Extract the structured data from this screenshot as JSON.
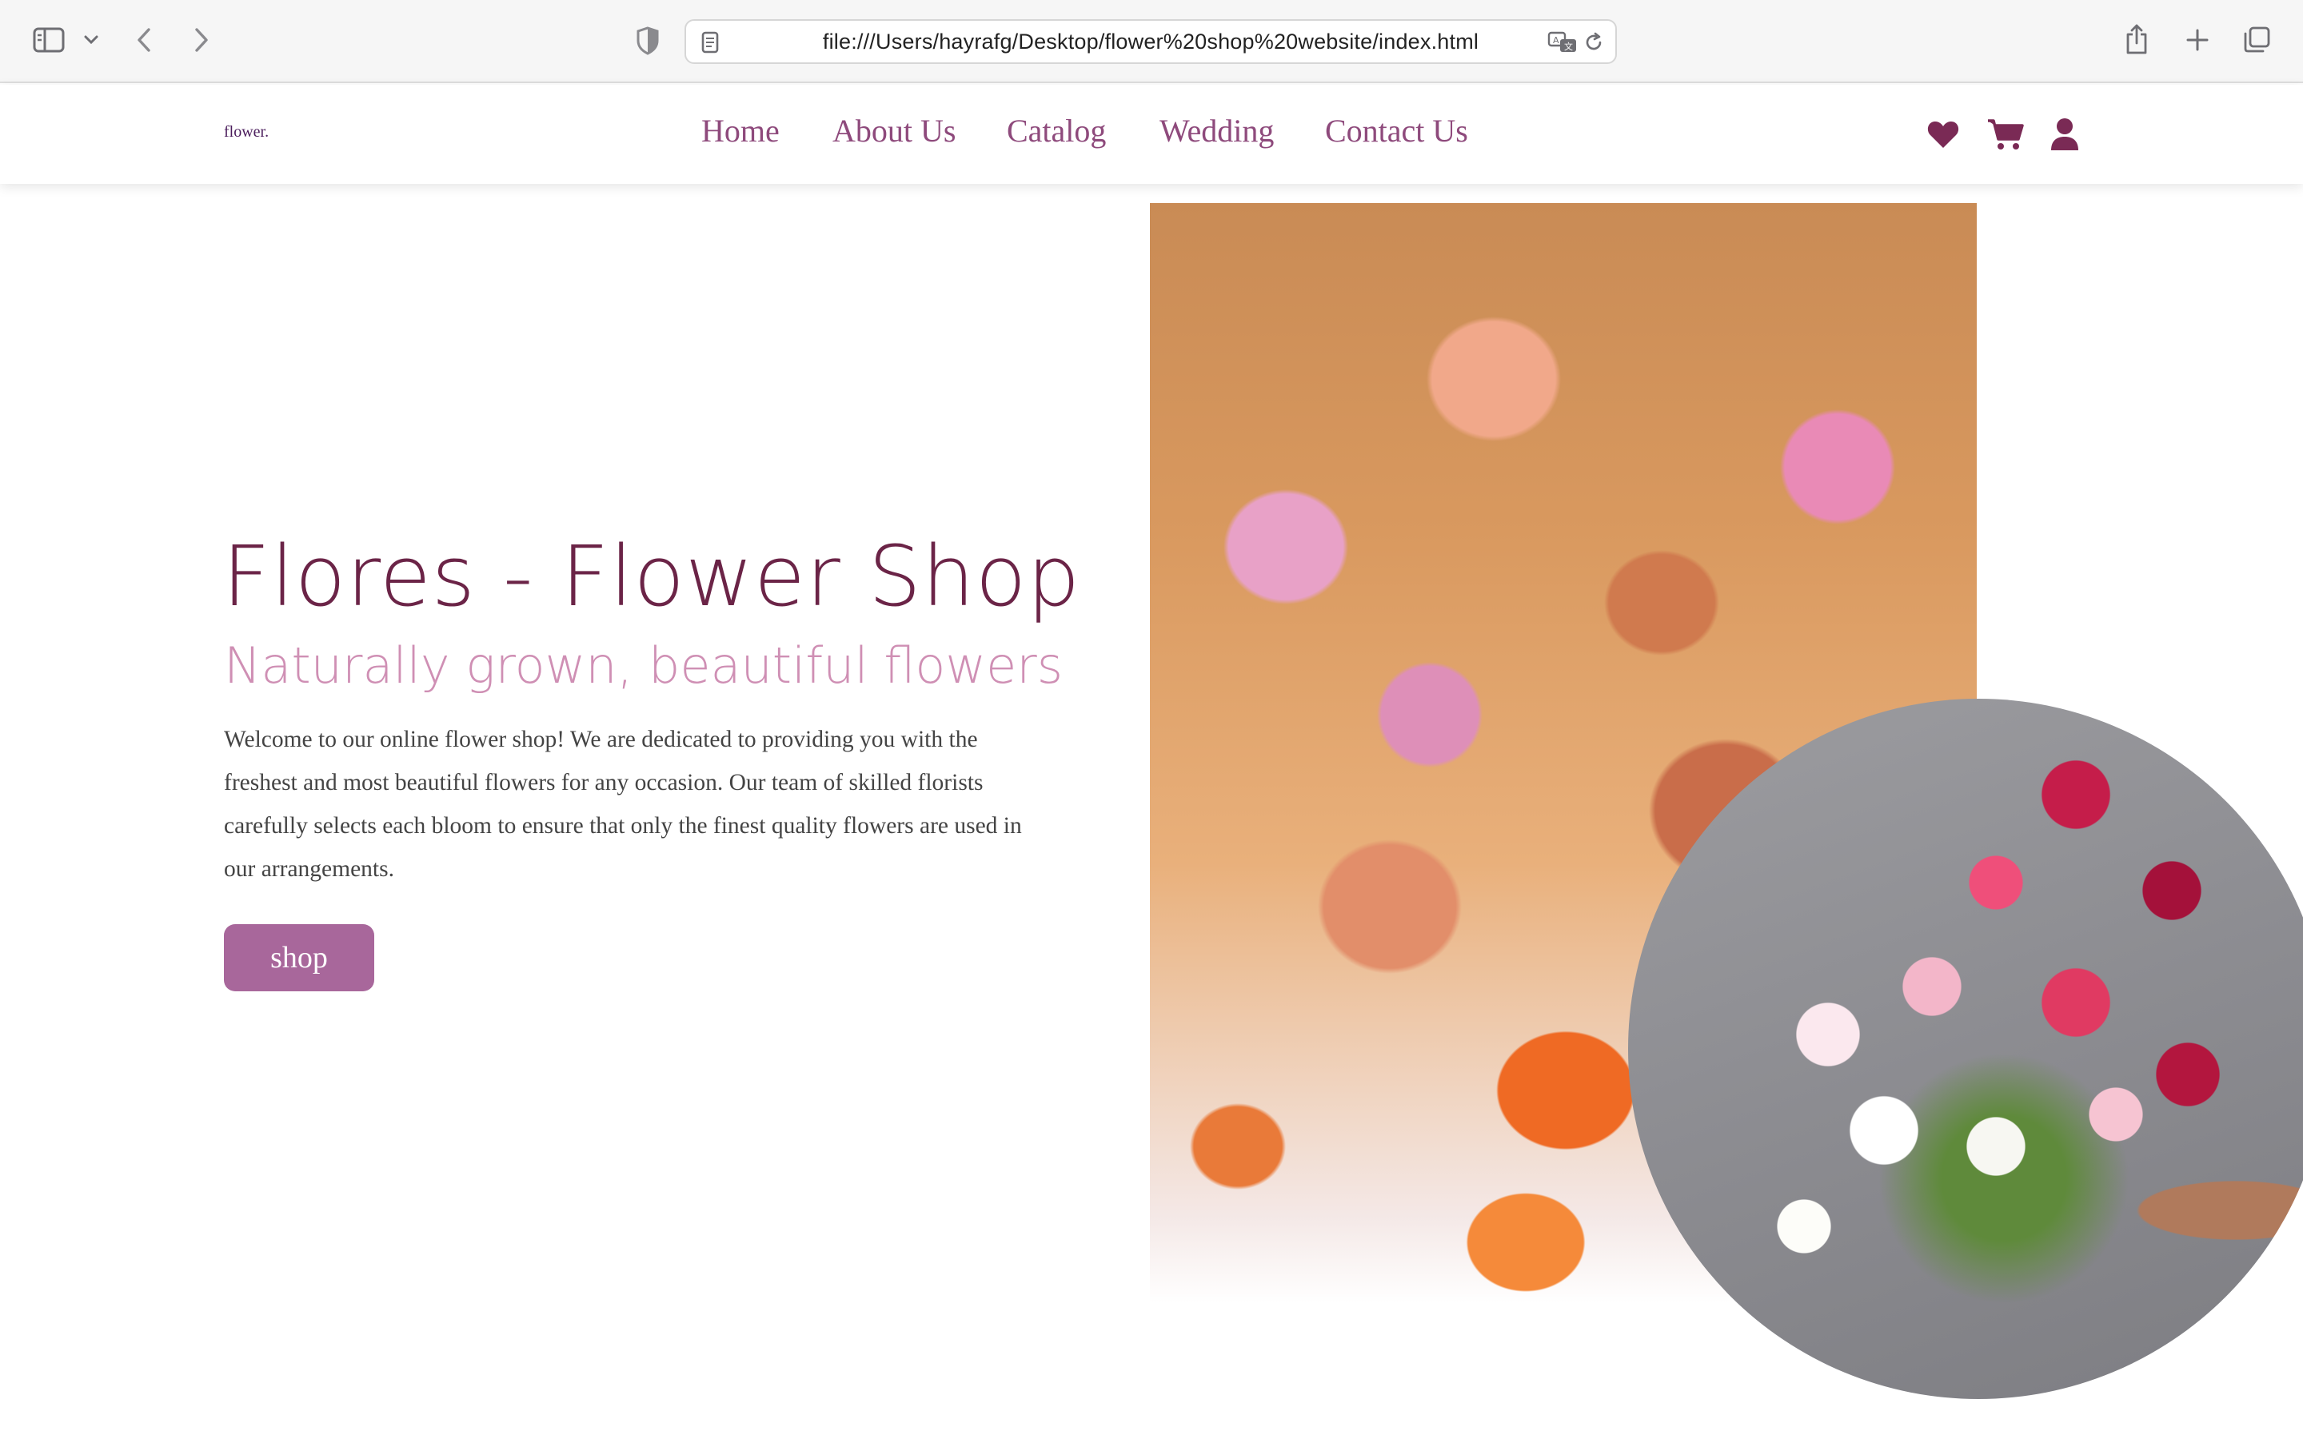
{
  "browser": {
    "url": "file:///Users/hayrafg/Desktop/flower%20shop%20website/index.html",
    "icons": {
      "sidebar": "sidebar-icon",
      "sidebar_menu": "chevron-down-icon",
      "back": "chevron-left-icon",
      "forward": "chevron-right-icon",
      "privacy": "shield-icon",
      "page": "page-icon",
      "translate": "translate-icon",
      "reload": "reload-icon",
      "share": "share-icon",
      "new_tab": "plus-icon",
      "tabs": "tabs-overview-icon"
    }
  },
  "header": {
    "logo": "flower.",
    "nav": [
      {
        "label": "Home"
      },
      {
        "label": "About Us"
      },
      {
        "label": "Catalog"
      },
      {
        "label": "Wedding"
      },
      {
        "label": "Contact Us"
      }
    ],
    "icons": [
      "heart-icon",
      "cart-icon",
      "user-icon"
    ]
  },
  "hero": {
    "title": "Flores - Flower Shop",
    "subtitle": "Naturally grown, beautiful flowers",
    "paragraph": "Welcome to our online flower shop! We are dedicated to providing you with the freshest and most beautiful flowers for any occasion. Our team of skilled florists carefully selects each bloom to ensure that only the finest quality flowers are used in our arrangements.",
    "button": "shop"
  },
  "colors": {
    "brand_dark": "#6b2447",
    "nav": "#8e4a7c",
    "subtitle": "#cf8fb4",
    "button": "#a8679b",
    "icon": "#7a2a55"
  }
}
